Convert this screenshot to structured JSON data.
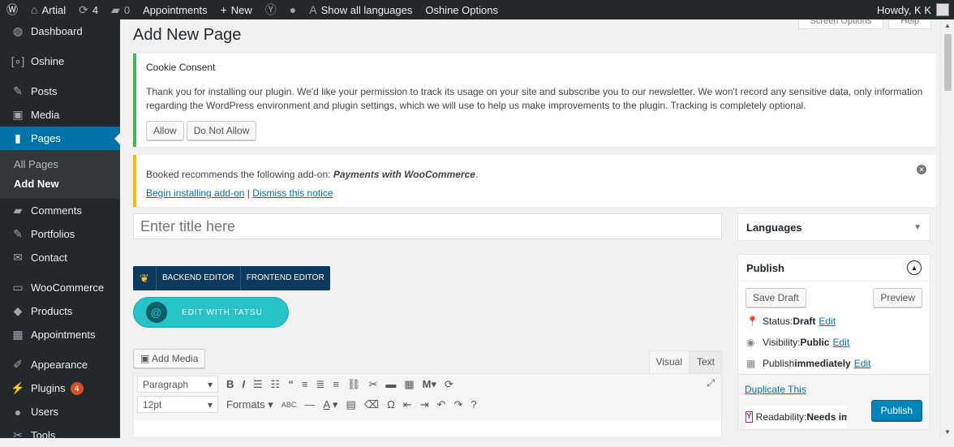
{
  "adminbar": {
    "site_name": "Artial",
    "updates": "4",
    "comments": "0",
    "appointments": "Appointments",
    "new": "New",
    "languages": "Show all languages",
    "theme_options": "Oshine Options",
    "howdy": "Howdy, K K"
  },
  "screen_tabs": {
    "screen_options": "Screen Options",
    "help": "Help"
  },
  "sidebar": {
    "dashboard": "Dashboard",
    "oshine": "Oshine",
    "posts": "Posts",
    "media": "Media",
    "pages": "Pages",
    "all_pages": "All Pages",
    "add_new": "Add New",
    "comments": "Comments",
    "portfolios": "Portfolios",
    "contact": "Contact",
    "woocommerce": "WooCommerce",
    "products": "Products",
    "appointments": "Appointments",
    "appearance": "Appearance",
    "plugins": "Plugins",
    "plugins_badge": "4",
    "users": "Users",
    "tools": "Tools"
  },
  "page": {
    "title": "Add New Page"
  },
  "cookie_notice": {
    "heading": "Cookie Consent",
    "text": "Thank you for installing our plugin. We'd like your permission to track its usage on your site and subscribe you to our newsletter. We won't record any sensitive data, only information regarding the WordPress environment and plugin settings, which we will use to help us make improvements to the plugin. Tracking is completely optional.",
    "allow": "Allow",
    "deny": "Do Not Allow"
  },
  "booked_notice": {
    "text_pre": "Booked recommends the following add-on: ",
    "addon": "Payments with WooCommerce",
    "text_post": ".",
    "install": "Begin installing add-on",
    "separator": " | ",
    "dismiss": "Dismiss this notice"
  },
  "editor": {
    "title_placeholder": "Enter title here",
    "backend": "BACKEND EDITOR",
    "frontend": "FRONTEND EDITOR",
    "tatsu": "EDIT WITH TATSU",
    "add_media": "Add Media",
    "tab_visual": "Visual",
    "tab_text": "Text",
    "format_select": "Paragraph",
    "font_size": "12pt",
    "formats": "Formats"
  },
  "languages_box": {
    "title": "Languages"
  },
  "publish_box": {
    "title": "Publish",
    "save_draft": "Save Draft",
    "preview": "Preview",
    "status_label": "Status: ",
    "status_value": "Draft",
    "visibility_label": "Visibility: ",
    "visibility_value": "Public",
    "publish_label": "Publish ",
    "publish_value": "immediately",
    "edit": "Edit",
    "duplicate": "Duplicate This",
    "readability_label": "Readability: ",
    "readability_value": "Needs im",
    "publish_btn": "Publish"
  },
  "colors": {
    "admin_bar": "#23282d",
    "accent": "#0073aa",
    "notice_success": "#46b450",
    "notice_warning": "#ffb900",
    "tatsu": "#28c3c7",
    "vc_bar": "#0b3a5c"
  }
}
